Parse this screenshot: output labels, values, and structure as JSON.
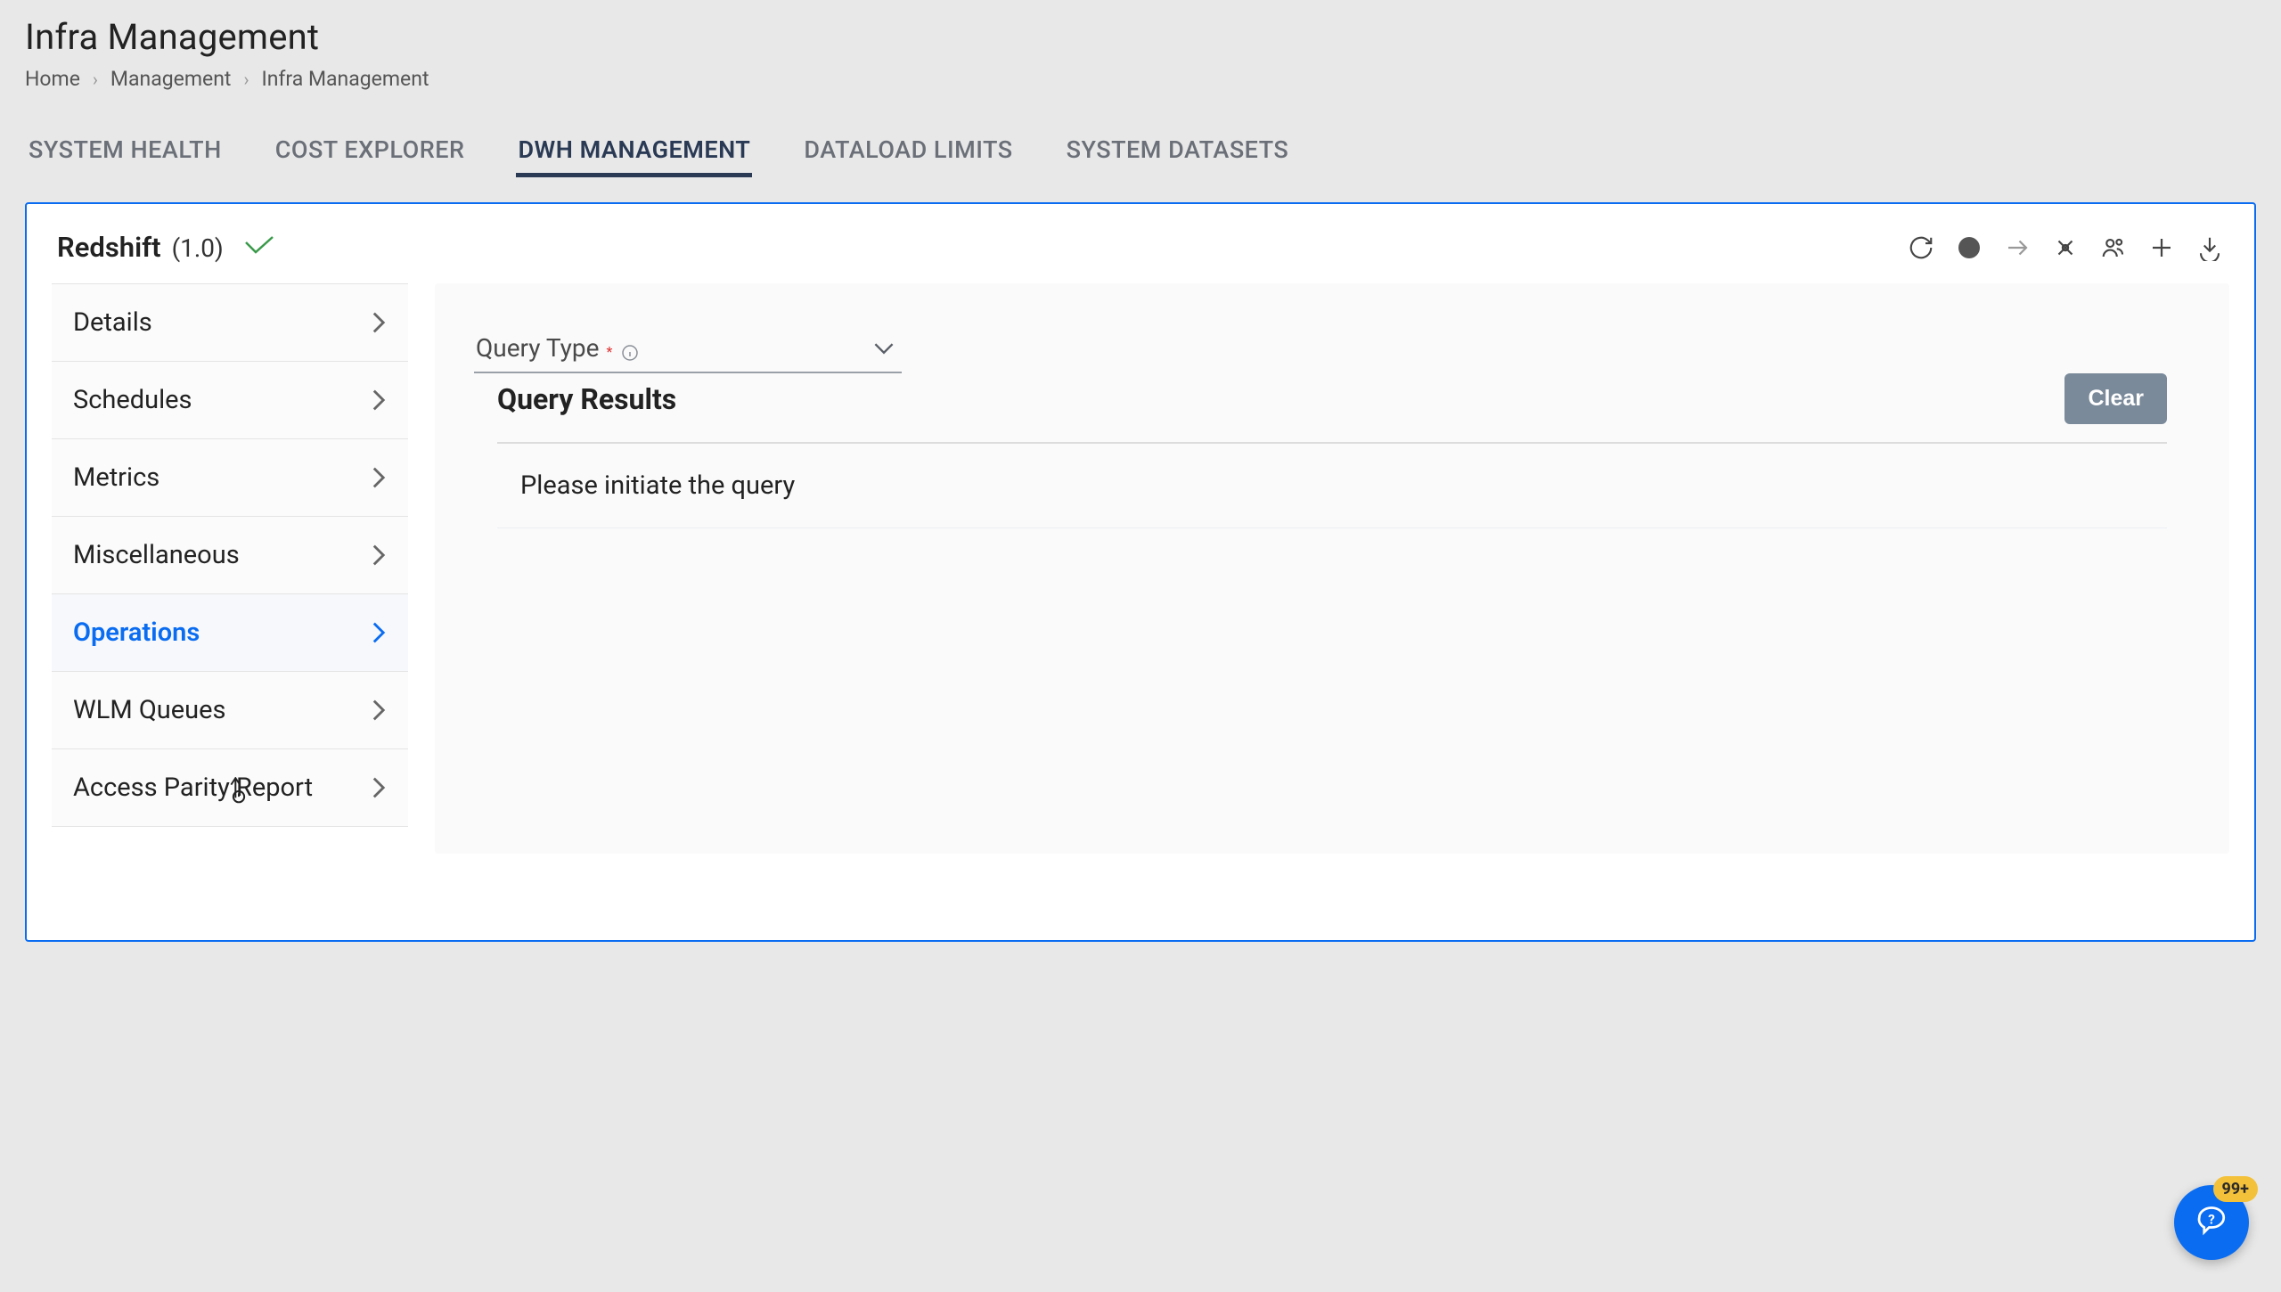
{
  "page": {
    "title": "Infra Management"
  },
  "breadcrumb": {
    "items": [
      {
        "label": "Home"
      },
      {
        "label": "Management"
      },
      {
        "label": "Infra Management"
      }
    ]
  },
  "tabs": [
    {
      "label": "SYSTEM HEALTH",
      "active": false
    },
    {
      "label": "COST EXPLORER",
      "active": false
    },
    {
      "label": "DWH MANAGEMENT",
      "active": true
    },
    {
      "label": "DATALOAD LIMITS",
      "active": false
    },
    {
      "label": "SYSTEM DATASETS",
      "active": false
    }
  ],
  "panel": {
    "title": "Redshift",
    "version": "(1.0)"
  },
  "sidebar": {
    "items": [
      {
        "label": "Details",
        "active": false
      },
      {
        "label": "Schedules",
        "active": false
      },
      {
        "label": "Metrics",
        "active": false
      },
      {
        "label": "Miscellaneous",
        "active": false
      },
      {
        "label": "Operations",
        "active": true
      },
      {
        "label": "WLM Queues",
        "active": false
      },
      {
        "label": "Access Parity Report",
        "active": false
      }
    ]
  },
  "query": {
    "label": "Query Type",
    "required": "*"
  },
  "results": {
    "title": "Query Results",
    "clear_label": "Clear",
    "empty_message": "Please initiate the query"
  },
  "help": {
    "badge": "99+"
  }
}
